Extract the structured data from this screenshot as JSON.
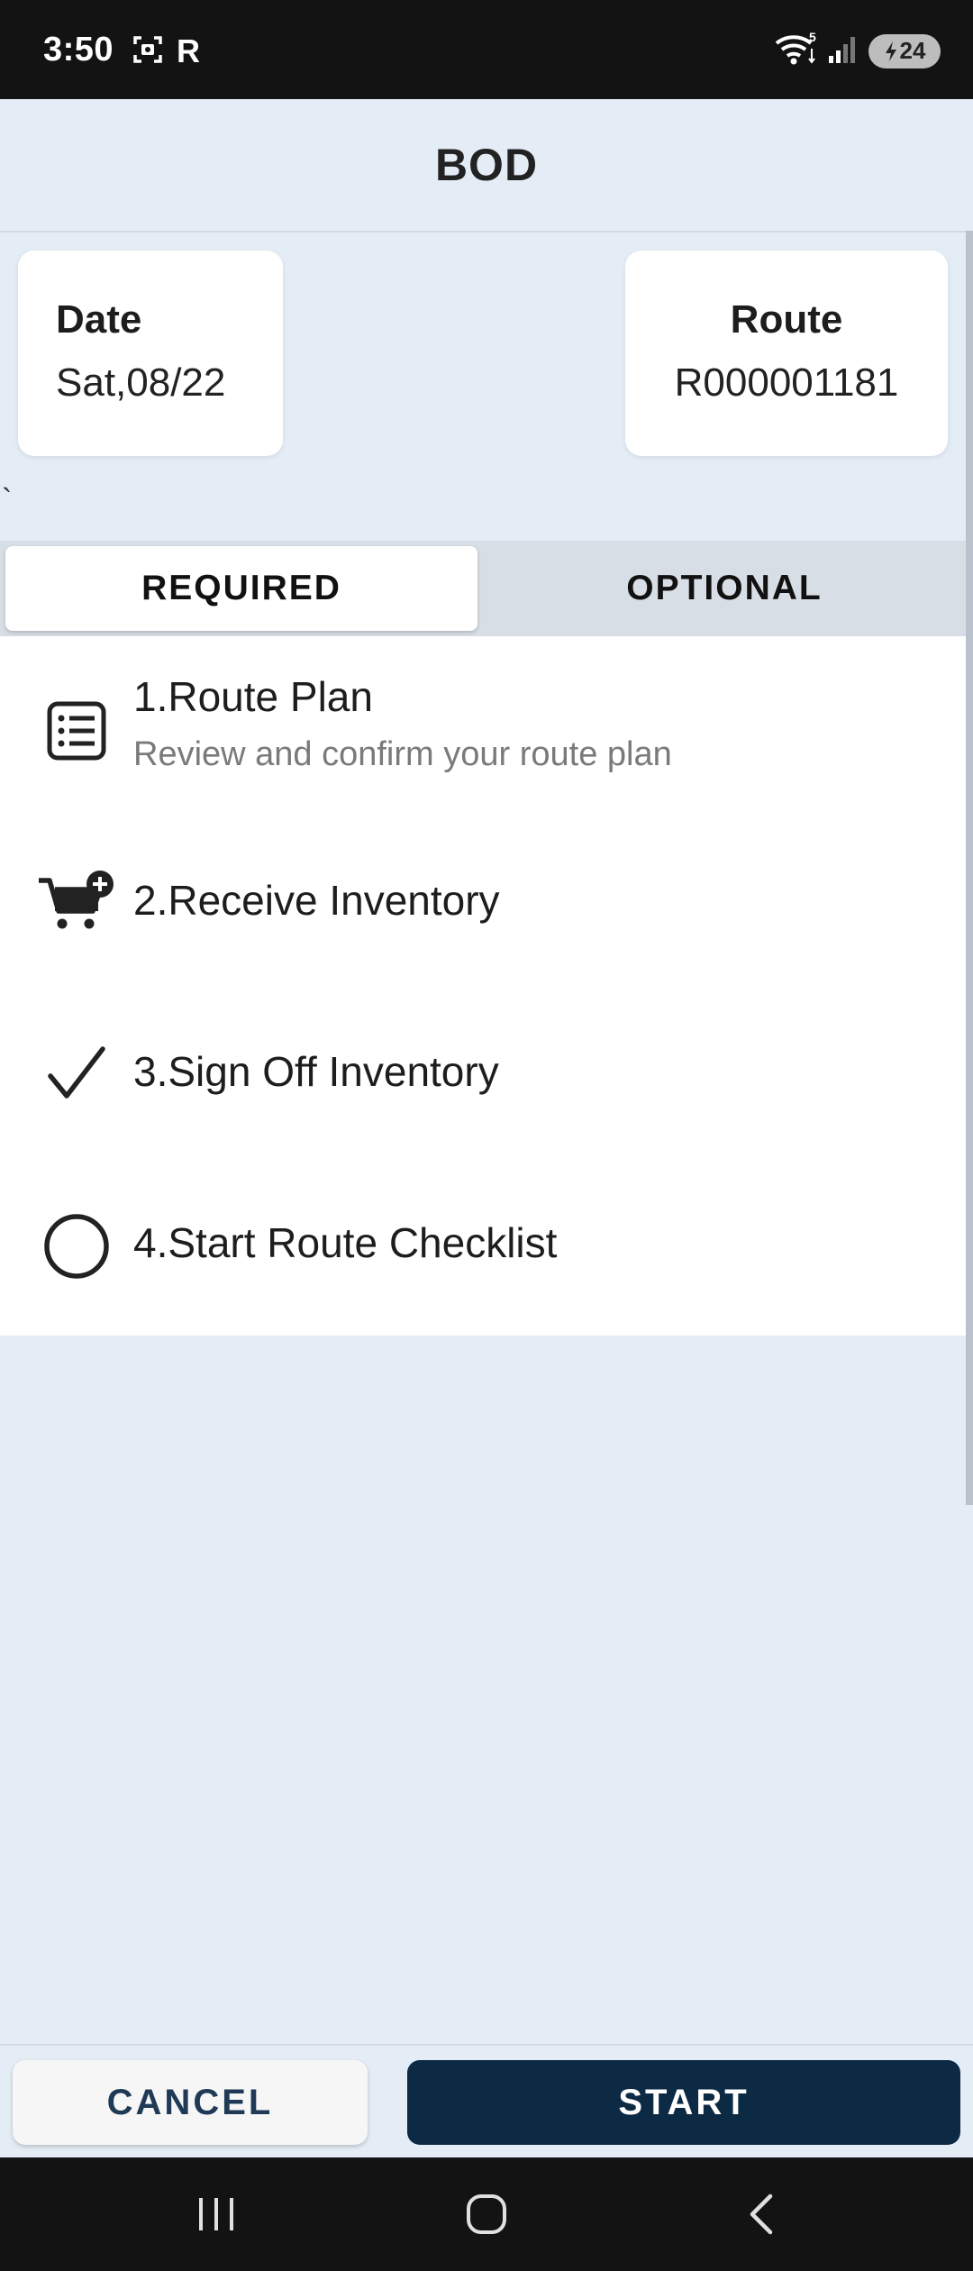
{
  "status_bar": {
    "time": "3:50",
    "carrier_indicator": "R",
    "wifi_label": "5",
    "battery_level": "24",
    "icons": [
      "screenshot-icon",
      "wifi-icon",
      "signal-icon",
      "battery-charging-icon"
    ]
  },
  "header": {
    "title": "BOD"
  },
  "info": {
    "date_label": "Date",
    "date_value": "Sat,08/22",
    "route_label": "Route",
    "route_value": "R000001181",
    "stray_mark": "`"
  },
  "tabs": {
    "required": "REQUIRED",
    "optional": "OPTIONAL",
    "active": "REQUIRED"
  },
  "tasks": [
    {
      "title": "1.Route Plan",
      "subtitle": "Review and confirm your route plan",
      "icon": "list-icon"
    },
    {
      "title": "2.Receive Inventory",
      "icon": "cart-add-icon"
    },
    {
      "title": "3.Sign Off Inventory",
      "icon": "checkmark-icon"
    },
    {
      "title": "4.Start Route Checklist",
      "icon": "circle-icon"
    }
  ],
  "actions": {
    "cancel_label": "CANCEL",
    "start_label": "START"
  },
  "colors": {
    "background": "#e4ecf5",
    "start_button": "#0d2a45",
    "cancel_text": "#1f3a56",
    "status_bar": "#131313"
  }
}
